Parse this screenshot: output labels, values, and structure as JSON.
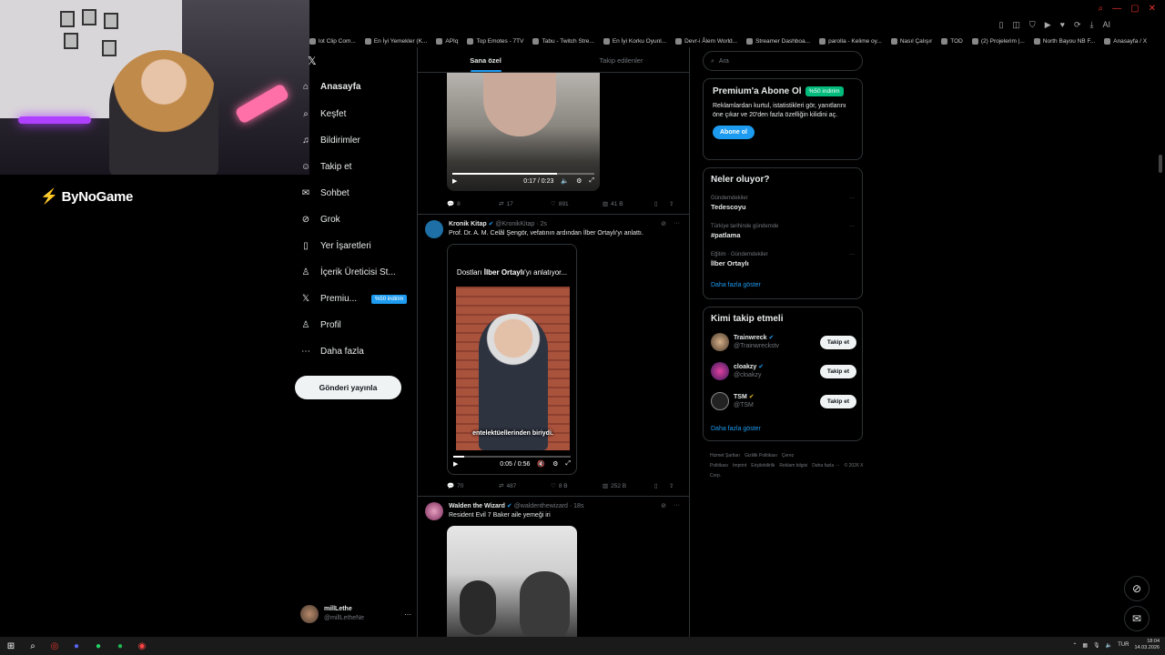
{
  "overlay": {
    "logo_text": "ByNoGame"
  },
  "bookmarks": [
    "lot Clip Com...",
    "En İyi Yemekler (K...",
    "APIq",
    "Top Emotes - 7TV",
    "Tabu - Twitch Stre...",
    "En İyi Korku Oyunl...",
    "Devr-i Âlem World...",
    "Streamer Dashboa...",
    "parolla - Kelime oy...",
    "Nasıl Çalışır",
    "TOD",
    "(2) Projelerim |...",
    "North Bayou NB F...",
    "Anasayfa / X"
  ],
  "nav": {
    "items": [
      {
        "label": "Anasayfa",
        "icon": "home-icon",
        "glyph": "⌂"
      },
      {
        "label": "Keşfet",
        "icon": "search-icon",
        "glyph": "⌕"
      },
      {
        "label": "Bildirimler",
        "icon": "bell-icon",
        "glyph": "♫"
      },
      {
        "label": "Takip et",
        "icon": "person-plus-icon",
        "glyph": "☺"
      },
      {
        "label": "Sohbet",
        "icon": "mail-icon",
        "glyph": "✉"
      },
      {
        "label": "Grok",
        "icon": "grok-icon",
        "glyph": "⊘"
      },
      {
        "label": "Yer İşaretleri",
        "icon": "bookmark-icon",
        "glyph": "▯"
      },
      {
        "label": "İçerik Üreticisi St...",
        "icon": "creator-icon",
        "glyph": "♙"
      },
      {
        "label": "Premiu...",
        "icon": "x-logo-icon",
        "glyph": "𝕏",
        "badge": "%50 indirim"
      },
      {
        "label": "Profil",
        "icon": "profile-icon",
        "glyph": "♙"
      },
      {
        "label": "Daha fazla",
        "icon": "more-circle-icon",
        "glyph": "⋯"
      }
    ],
    "post_button": "Gönderi yayınla",
    "account": {
      "name": "millLethe",
      "handle": "@millLetheNe"
    }
  },
  "timeline": {
    "tabs": [
      "Sana özel",
      "Takip edilenler"
    ],
    "tweet1": {
      "video_time": "0:17 / 0:23",
      "video_progress": 0.74,
      "actions": {
        "replies": "8",
        "reposts": "17",
        "likes": "891",
        "views": "41 B"
      }
    },
    "tweet2": {
      "name": "Kronik Kitap",
      "handle": "@KronikKitap · 2s",
      "text": "Prof. Dr. A. M. Celâl Şengör, vefatının ardından İlber Ortaylı'yı anlattı.",
      "video_caption_pre": "Dostları ",
      "video_caption_bold": "İlber Ortaylı",
      "video_caption_post": "'yı anlatıyor...",
      "video_subtitle": "entelektüellerinden biriydi.",
      "video_time": "0:05 / 0:56",
      "video_progress": 0.09,
      "actions": {
        "replies": "70",
        "reposts": "487",
        "likes": "8 B",
        "views": "252 B"
      }
    },
    "tweet3": {
      "name": "Walden the Wizard",
      "handle": "@waldenthewizard · 18s",
      "text": "Resident Evil 7 Baker aile yemeği iri"
    }
  },
  "right": {
    "search_placeholder": "Ara",
    "premium": {
      "title": "Premium'a Abone Ol",
      "discount": "%50 indirim",
      "body": "Reklamlardan kurtul, istatistikleri gör, yanıtlarını öne çıkar ve 20'den fazla özelliğin kilidini aç.",
      "button": "Abone ol"
    },
    "trends": {
      "title": "Neler oluyor?",
      "items": [
        {
          "context": "Gündemdekiler",
          "topic": "Tedescoyu"
        },
        {
          "context": "Türkiye tarihinde gündemde",
          "topic": "#patlama"
        },
        {
          "context": "Eğitim · Gündemdekiler",
          "topic": "İlber Ortaylı"
        }
      ],
      "show_more": "Daha fazla göster"
    },
    "follow": {
      "title": "Kimi takip etmeli",
      "items": [
        {
          "name": "Trainwreck",
          "handle": "@Trainwreckstv",
          "button": "Takip et"
        },
        {
          "name": "cloakzy",
          "handle": "@cloakzy",
          "button": "Takip et"
        },
        {
          "name": "TSM",
          "handle": "@TSM",
          "button": "Takip et"
        }
      ],
      "show_more": "Daha fazla göster"
    },
    "footer": [
      "Hizmet Şartları",
      "Gizlilik Politikası",
      "Çerez Politikası",
      "Imprint",
      "Erişilebilirlik",
      "Reklam bilgisi",
      "Daha fazla ···",
      "© 2026 X Corp."
    ]
  },
  "taskbar": {
    "lang": "TUR",
    "time": "18:04",
    "date": "14.03.2026"
  }
}
